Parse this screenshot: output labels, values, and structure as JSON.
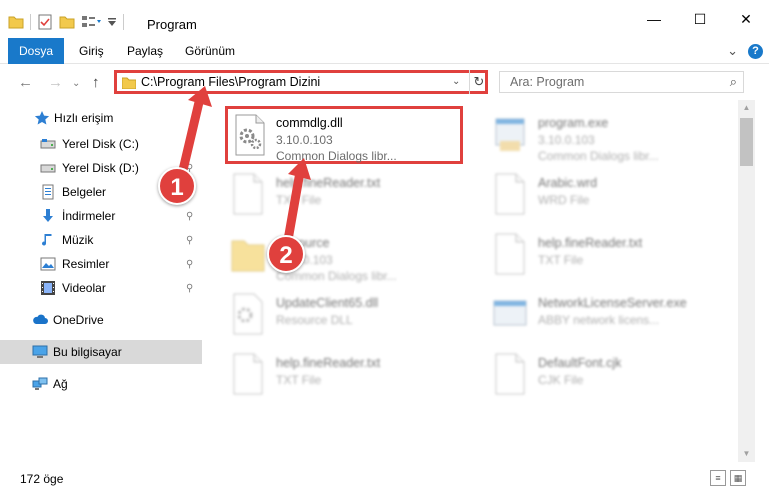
{
  "window": {
    "title": "Program",
    "minimize_glyph": "—",
    "maximize_glyph": "☐",
    "close_glyph": "✕"
  },
  "ribbon": {
    "tabs": [
      "Dosya",
      "Giriş",
      "Paylaş",
      "Görünüm"
    ],
    "expand_glyph": "⌄",
    "help_glyph": "?"
  },
  "nav": {
    "back_glyph": "←",
    "forward_glyph": "→",
    "recent_glyph": "⌄",
    "up_glyph": "↑"
  },
  "address": {
    "path": "C:\\Program Files\\Program Dizini",
    "dropdown_glyph": "⌄",
    "refresh_glyph": "↻"
  },
  "search": {
    "placeholder": "Ara: Program",
    "icon_glyph": "⌕"
  },
  "sidebar": {
    "items": [
      {
        "label": "Hızlı erişim",
        "icon": "star-icon"
      },
      {
        "label": "Yerel Disk (C:)",
        "icon": "drive-icon"
      },
      {
        "label": "Yerel Disk (D:)",
        "icon": "drive-icon"
      },
      {
        "label": "Belgeler",
        "icon": "documents-icon"
      },
      {
        "label": "İndirmeler",
        "icon": "download-icon"
      },
      {
        "label": "Müzik",
        "icon": "music-icon"
      },
      {
        "label": "Resimler",
        "icon": "pictures-icon"
      },
      {
        "label": "Videolar",
        "icon": "video-icon"
      },
      {
        "label": "OneDrive",
        "icon": "cloud-icon"
      },
      {
        "label": "Bu bilgisayar",
        "icon": "computer-icon"
      },
      {
        "label": "Ağ",
        "icon": "network-icon"
      }
    ],
    "pin_glyph": "📌"
  },
  "files": [
    {
      "name": "commdlg.dll",
      "line2": "3.10.0.103",
      "line3": "Common Dialogs libr..."
    },
    {
      "name": "program.exe",
      "line2": "3.10.0.103",
      "line3": "Common Dialogs libr..."
    },
    {
      "name": "help.fineReader.txt",
      "line2": "TXT File",
      "line3": ""
    },
    {
      "name": "Arabic.wrd",
      "line2": "WRD File",
      "line3": ""
    },
    {
      "name": "Resource",
      "line2": "3.10.0.103",
      "line3": "Common Dialogs libr..."
    },
    {
      "name": "help.fineReader.txt",
      "line2": "TXT File",
      "line3": ""
    },
    {
      "name": "UpdateClient65.dll",
      "line2": "Resource DLL",
      "line3": ""
    },
    {
      "name": "NetworkLicenseServer.exe",
      "line2": "ABBY network licens...",
      "line3": ""
    },
    {
      "name": "help.fineReader.txt",
      "line2": "TXT File",
      "line3": ""
    },
    {
      "name": "DefaultFont.cjk",
      "line2": "CJK File",
      "line3": ""
    }
  ],
  "scrollbar": {
    "up_glyph": "▲",
    "down_glyph": "▼"
  },
  "status": {
    "count": "172 öge",
    "details_glyph": "≡",
    "tiles_glyph": "▦"
  },
  "annotations": {
    "step1": "1",
    "step2": "2"
  },
  "colors": {
    "accent": "#1979ca",
    "annotation": "#e0403d",
    "folder": "#f2c94c"
  }
}
